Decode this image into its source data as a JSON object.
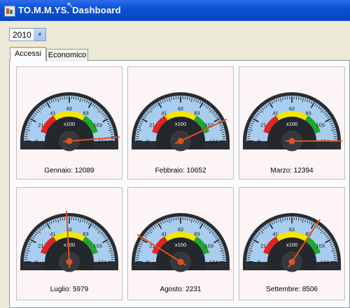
{
  "window": {
    "title": "TO.M.M.YS. Dashboard"
  },
  "year_select": {
    "value": "2010"
  },
  "tabs": [
    {
      "label": "Accessi"
    },
    {
      "label": "Economico"
    }
  ],
  "gauge_scale": {
    "ticks": [
      "0",
      "21",
      "41",
      "62",
      "83",
      "103",
      "124"
    ],
    "multiplier": "x100",
    "min": 0,
    "max": 124
  },
  "gauges": [
    {
      "month": "Gennaio",
      "value": 12089,
      "label": "Gennaio: 12089"
    },
    {
      "month": "Febbraio",
      "value": 10652,
      "label": "Febbraio: 10652"
    },
    {
      "month": "Marzo",
      "value": 12394,
      "label": "Marzo: 12394"
    },
    {
      "month": "Luglio",
      "value": 5979,
      "label": "Luglio: 5979"
    },
    {
      "month": "Agosto",
      "value": 2231,
      "label": "Agosto: 2231"
    },
    {
      "month": "Settembre",
      "value": 8506,
      "label": "Settembre: 8506"
    }
  ],
  "colors": {
    "title_bar": "#0a52d6",
    "gauge_face": "#a8cdef",
    "needle": "#e0531b",
    "zone_red": "#e32222",
    "zone_yellow": "#f5e500",
    "zone_green": "#21a62c"
  }
}
